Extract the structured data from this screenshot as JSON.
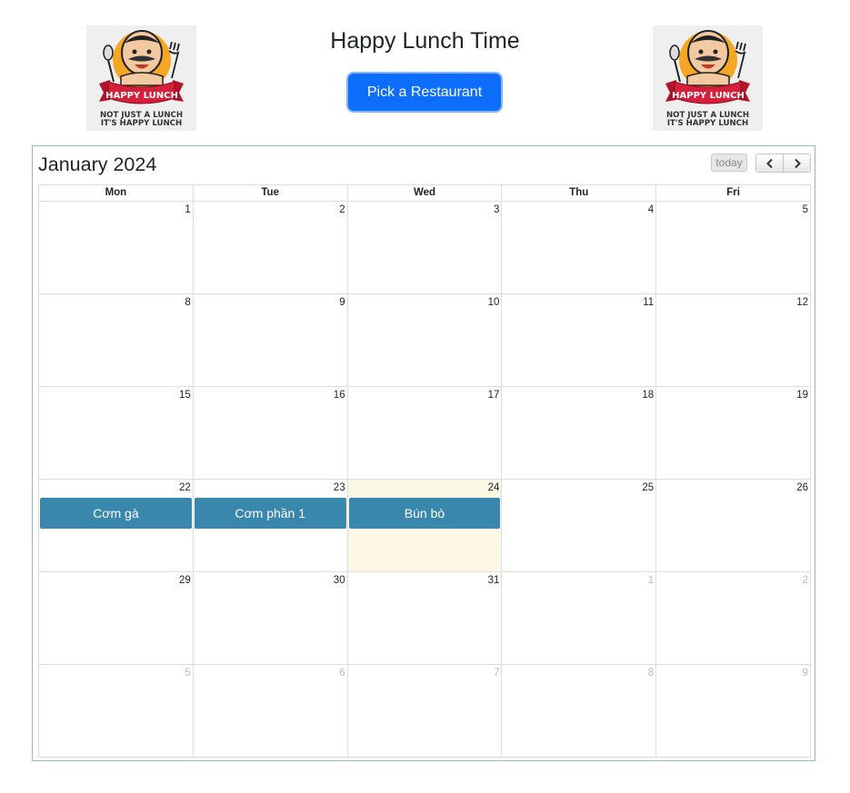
{
  "header": {
    "title": "Happy Lunch Time",
    "pick_button": "Pick a Restaurant",
    "logo": {
      "banner_text": "HAPPY LUNCH",
      "caption_line1": "NOT JUST A LUNCH",
      "caption_line2": "IT'S HAPPY LUNCH"
    }
  },
  "calendar": {
    "title": "January 2024",
    "today_button": "today",
    "prev_icon": "chevron-left-icon",
    "next_icon": "chevron-right-icon",
    "weekdays": [
      "Mon",
      "Tue",
      "Wed",
      "Thu",
      "Fri"
    ],
    "weeks": [
      {
        "days": [
          {
            "num": "1"
          },
          {
            "num": "2"
          },
          {
            "num": "3"
          },
          {
            "num": "4"
          },
          {
            "num": "5"
          }
        ]
      },
      {
        "days": [
          {
            "num": "8"
          },
          {
            "num": "9"
          },
          {
            "num": "10"
          },
          {
            "num": "11"
          },
          {
            "num": "12"
          }
        ]
      },
      {
        "days": [
          {
            "num": "15"
          },
          {
            "num": "16"
          },
          {
            "num": "17"
          },
          {
            "num": "18"
          },
          {
            "num": "19"
          }
        ]
      },
      {
        "days": [
          {
            "num": "22",
            "event": "Cơm gà"
          },
          {
            "num": "23",
            "event": "Cơm phần 1"
          },
          {
            "num": "24",
            "event": "Bún bò",
            "today": true
          },
          {
            "num": "25"
          },
          {
            "num": "26"
          }
        ]
      },
      {
        "days": [
          {
            "num": "29"
          },
          {
            "num": "30"
          },
          {
            "num": "31"
          },
          {
            "num": "1",
            "other": true
          },
          {
            "num": "2",
            "other": true
          }
        ]
      },
      {
        "days": [
          {
            "num": "5",
            "other": true
          },
          {
            "num": "6",
            "other": true
          },
          {
            "num": "7",
            "other": true
          },
          {
            "num": "8",
            "other": true
          },
          {
            "num": "9",
            "other": true
          }
        ]
      }
    ]
  },
  "colors": {
    "primary_button": "#0d6efd",
    "event_bg": "#3a87ad",
    "today_bg": "#fcf8e3",
    "calendar_border": "#8fbfb5"
  }
}
